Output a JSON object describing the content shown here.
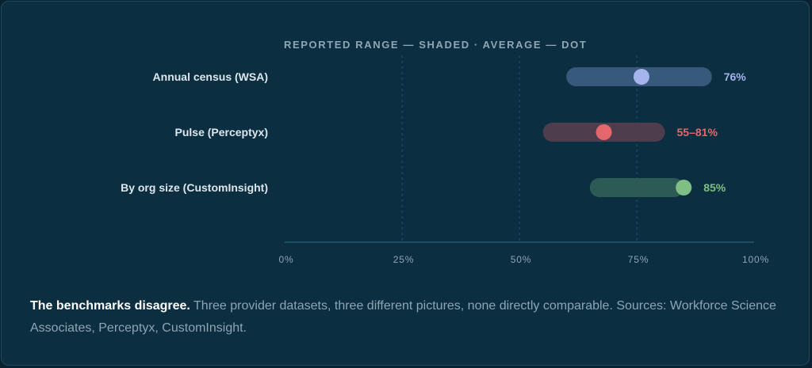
{
  "chart_data": {
    "type": "range-dot",
    "legend_title": "REPORTED RANGE — SHADED · AVERAGE — DOT",
    "x_ticks": [
      "0%",
      "25%",
      "50%",
      "75%",
      "100%"
    ],
    "xlim": [
      0,
      100
    ],
    "rows": [
      {
        "label": "Annual census (WSA)",
        "range": [
          60,
          91
        ],
        "dot": 76,
        "value_label": "76%",
        "color": "#a6b4ee",
        "bar_color": "#37597b"
      },
      {
        "label": "Pulse (Perceptyx)",
        "range": [
          55,
          81
        ],
        "dot": 68,
        "value_label": "55–81%",
        "color": "#e3676d",
        "bar_color": "#4e3d4d"
      },
      {
        "label": "By org size (CustomInsight)",
        "range": [
          65,
          85
        ],
        "dot": 85,
        "value_label": "85%",
        "color": "#7fbf84",
        "bar_color": "#2c5a55"
      }
    ]
  },
  "caption": {
    "lead": "The benchmarks disagree.",
    "body": " Three provider datasets, three different pictures, none directly comparable. Sources: Workforce Science Associates, Perceptyx, CustomInsight."
  }
}
